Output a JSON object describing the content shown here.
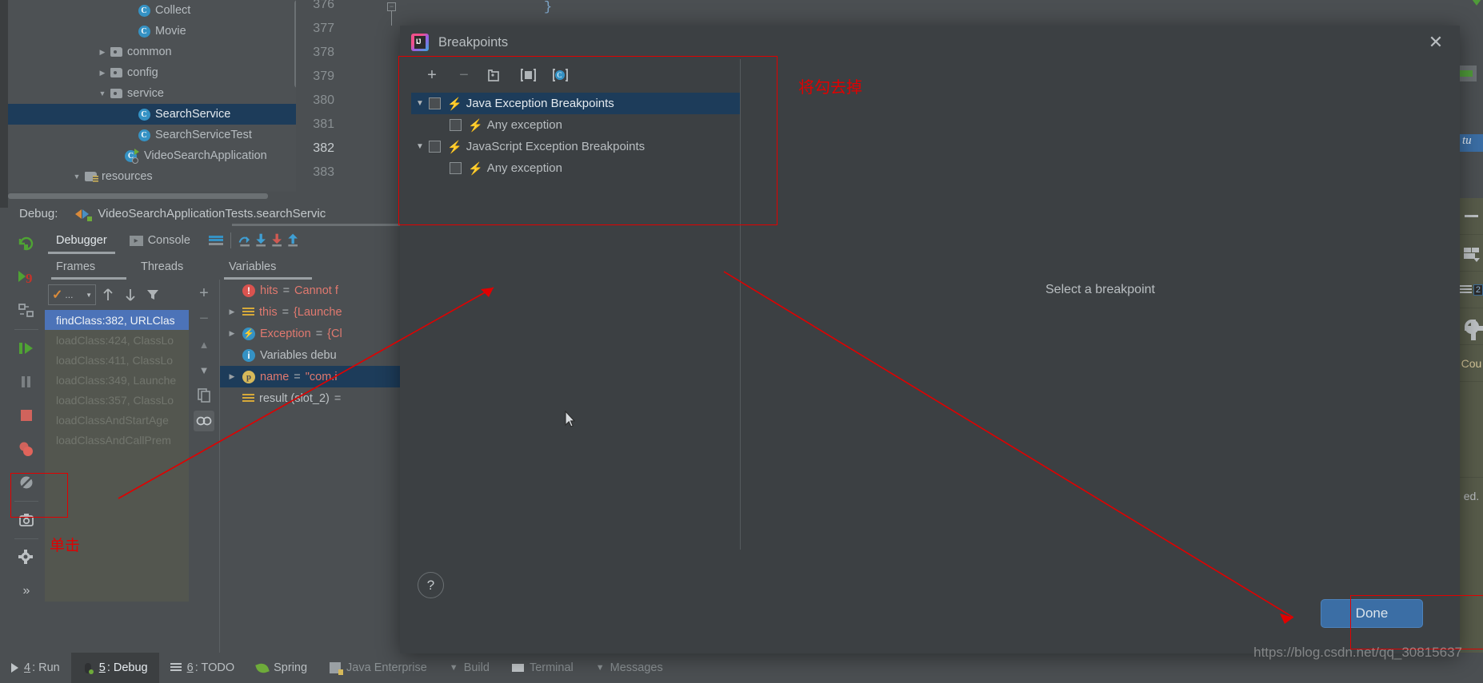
{
  "project_tree": {
    "items": [
      {
        "label": "Collect",
        "icon": "class-icon",
        "indent": 3,
        "arrow": "",
        "selected": false
      },
      {
        "label": "Movie",
        "icon": "class-icon",
        "indent": 3,
        "arrow": "",
        "selected": false
      },
      {
        "label": "common",
        "icon": "folder-icon",
        "indent": 2,
        "arrow": "▶",
        "selected": false
      },
      {
        "label": "config",
        "icon": "folder-icon",
        "indent": 2,
        "arrow": "▶",
        "selected": false
      },
      {
        "label": "service",
        "icon": "folder-icon",
        "indent": 2,
        "arrow": "▼",
        "selected": false
      },
      {
        "label": "SearchService",
        "icon": "class-icon",
        "indent": 3,
        "arrow": "",
        "selected": true
      },
      {
        "label": "SearchServiceTest",
        "icon": "class-icon",
        "indent": 3,
        "arrow": "",
        "selected": false
      },
      {
        "label": "VideoSearchApplication",
        "icon": "runnable-class-icon",
        "indent": 2,
        "arrow": "",
        "selected": false
      },
      {
        "label": "resources",
        "icon": "resources-folder-icon",
        "indent": 1,
        "arrow": "▼",
        "selected": false
      }
    ]
  },
  "editor": {
    "line_numbers": [
      "376",
      "377",
      "378",
      "379",
      "380",
      "381",
      "382",
      "383"
    ],
    "current_line": "382",
    "code_fragment": "}",
    "fold_glyph": "−",
    "right_selection_text": "tu"
  },
  "right_strip": {
    "items": [
      {
        "icon": "minimize-icon",
        "label": ""
      },
      {
        "icon": "layout-windows-icon",
        "label": ""
      },
      {
        "icon": "list-lines-icon",
        "label": "2"
      },
      {
        "icon": "gear-icon",
        "label": ""
      },
      {
        "icon": "text-label",
        "label": "Cou"
      },
      {
        "icon": "text-label",
        "label": "ed."
      }
    ]
  },
  "debug": {
    "label": "Debug:",
    "config_name": "VideoSearchApplicationTests.searchServic",
    "tabs": [
      {
        "label": "Debugger",
        "icon": "",
        "active": true
      },
      {
        "label": "Console",
        "icon": "console-icon",
        "active": false
      }
    ],
    "sub_tabs": [
      {
        "label": "Frames",
        "active": true
      },
      {
        "label": "Threads",
        "active": false
      },
      {
        "label": "Variables",
        "active": true
      }
    ],
    "frames_filter_value": "...",
    "frames": [
      {
        "label": "findClass:382, URLClas",
        "selected": true
      },
      {
        "label": "loadClass:424, ClassLo",
        "selected": false
      },
      {
        "label": "loadClass:411, ClassLo",
        "selected": false
      },
      {
        "label": "loadClass:349, Launche",
        "selected": false
      },
      {
        "label": "loadClass:357, ClassLo",
        "selected": false
      },
      {
        "label": "loadClassAndStartAge",
        "selected": false
      },
      {
        "label": "loadClassAndCallPrem",
        "selected": false
      }
    ],
    "variables": [
      {
        "arrow": "",
        "icon": "error-icon",
        "name": "hits",
        "eq": "=",
        "value": "Cannot f",
        "selected": false,
        "name_color": "red"
      },
      {
        "arrow": "▶",
        "icon": "object-icon",
        "name": "this",
        "eq": "=",
        "value": "{Launche",
        "selected": false,
        "name_color": "red"
      },
      {
        "arrow": "▶",
        "icon": "exception-icon",
        "name": "Exception",
        "eq": "=",
        "value": "{Cl",
        "selected": false,
        "name_color": "red"
      },
      {
        "arrow": "",
        "icon": "info-icon",
        "name": "Variables debu",
        "eq": "",
        "value": "",
        "selected": false,
        "name_color": "plain"
      },
      {
        "arrow": "▶",
        "icon": "param-icon",
        "name": "name",
        "eq": "=",
        "value": "\"com.i",
        "selected": true,
        "name_color": "red"
      },
      {
        "arrow": "",
        "icon": "object-icon",
        "name": "result (slot_2)",
        "eq": "=",
        "value": "",
        "selected": false,
        "name_color": "plain"
      }
    ],
    "var_toolbar": [
      {
        "icon": "plus-icon",
        "label": "+"
      },
      {
        "icon": "minus-icon",
        "label": "−"
      },
      {
        "icon": "chevron-up-icon",
        "label": "▲"
      },
      {
        "icon": "chevron-down-icon",
        "label": "▼"
      },
      {
        "icon": "copy-icon",
        "label": ""
      },
      {
        "icon": "watches-icon",
        "label": ""
      }
    ]
  },
  "dialog": {
    "title": "Breakpoints",
    "close_label": "✕",
    "toolbar": [
      {
        "icon": "add-breakpoint-icon",
        "label": "+"
      },
      {
        "icon": "remove-breakpoint-icon",
        "label": "−"
      },
      {
        "icon": "group-by-file-icon",
        "label": ""
      },
      {
        "icon": "move-to-group-icon",
        "label": ""
      },
      {
        "icon": "view-breakpoint-class-icon",
        "label": ""
      }
    ],
    "breakpoint_groups": [
      {
        "arrow": "▼",
        "label": "Java Exception Breakpoints",
        "checked": false,
        "selected": true,
        "children": [
          {
            "label": "Any exception",
            "checked": false,
            "selected": false
          }
        ]
      },
      {
        "arrow": "▼",
        "label": "JavaScript Exception Breakpoints",
        "checked": false,
        "selected": false,
        "children": [
          {
            "label": "Any exception",
            "checked": false,
            "selected": false
          }
        ]
      }
    ],
    "detail_placeholder": "Select a breakpoint",
    "help_label": "?",
    "done_label": "Done"
  },
  "status_bar": {
    "items": [
      {
        "num": "4",
        "label": ": Run",
        "icon": "run-icon",
        "active": false
      },
      {
        "num": "5",
        "label": ": Debug",
        "icon": "debug-bug-icon",
        "active": true
      },
      {
        "num": "6",
        "label": ": TODO",
        "icon": "todo-icon",
        "active": false
      },
      {
        "num": "",
        "label": "Spring",
        "icon": "spring-leaf-icon",
        "active": false
      },
      {
        "num": "",
        "label": "Java Enterprise",
        "icon": "java-ee-icon",
        "active": false
      },
      {
        "num": "",
        "label": "Build",
        "icon": "build-icon",
        "active": false
      },
      {
        "num": "",
        "label": "Terminal",
        "icon": "terminal-icon",
        "active": false
      },
      {
        "num": "",
        "label": "Messages",
        "icon": "messages-icon",
        "active": false
      }
    ]
  },
  "annotations": {
    "uncheck_note": "将勾去掉",
    "click_note": "单击"
  },
  "watermark": "https://blog.csdn.net/qq_30815637",
  "colors": {
    "accent_blue": "#3b6ea5",
    "annotation_red": "#e10000",
    "selection_blue": "#1d3c5a",
    "frame_selection": "#4c73b8",
    "panel_bg": "#4b4f52",
    "dialog_bg": "#3c4043"
  }
}
